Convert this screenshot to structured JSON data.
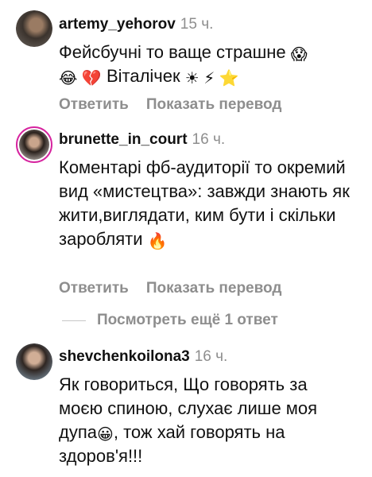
{
  "comments": [
    {
      "username": "artemy_yehorov",
      "time": "15 ч.",
      "text_line1": "Фейсбучні то ваще страшне",
      "text_line2": "Віталічек",
      "emoji_line1_end": "😱",
      "emoji_line2_start": "😂 💔",
      "emoji_line2_end": "☀ ⚡ ⭐",
      "reply_label": "Ответить",
      "translate_label": "Показать перевод"
    },
    {
      "username": "brunette_in_court",
      "time": "16 ч.",
      "text": "Коментарі фб-аудиторії то окремий вид «мистецтва»: завжди знають як жити,виглядати, ким бути  і скільки заробляти",
      "emoji_end": "🔥",
      "reply_label": "Ответить",
      "translate_label": "Показать перевод"
    },
    {
      "username": "shevchenkoilona3",
      "time": "16 ч.",
      "text_part1": "Як говориться, Що говорять за моєю спиною, слухає лише моя дупа",
      "emoji_mid": "😀",
      "text_part2": ", тож  хай говорять на здоров'я!!!"
    }
  ],
  "more_replies_label": "Посмотреть ещё 1 ответ",
  "colors": {
    "text": "#111111",
    "secondary": "#8e8e8e",
    "story_ring": "#d6249f"
  }
}
